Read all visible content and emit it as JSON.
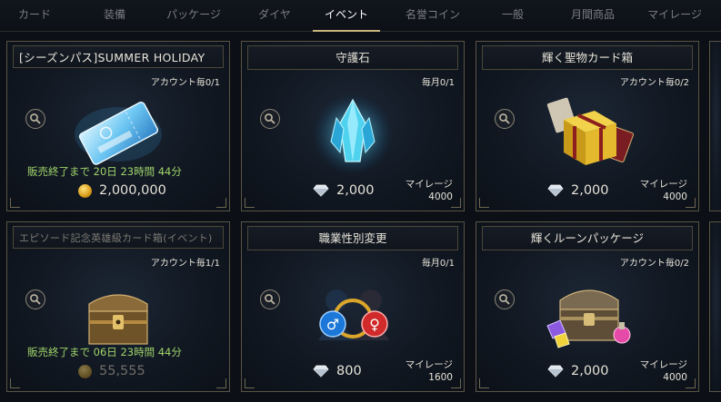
{
  "tabs": [
    {
      "label": "カード"
    },
    {
      "label": "装備"
    },
    {
      "label": "パッケージ"
    },
    {
      "label": "ダイヤ"
    },
    {
      "label": "イベント",
      "active": true
    },
    {
      "label": "名誉コイン"
    },
    {
      "label": "一般"
    },
    {
      "label": "月間商品"
    },
    {
      "label": "マイレージ"
    }
  ],
  "cards": [
    {
      "title": "[シーズンパス]SUMMER HOLIDAY",
      "limit": "アカウント毎0/1",
      "item_icon": "season-pass-ticket-icon",
      "countdown": "販売終了まで 20日 23時間 44分",
      "currency_icon": "gold-coin-icon",
      "price": "2,000,000"
    },
    {
      "title": "守護石",
      "limit": "毎月0/1",
      "item_icon": "guardian-stone-icon",
      "currency_icon": "diamond-icon",
      "price": "2,000",
      "mileage_label": "マイレージ",
      "mileage_value": "4000"
    },
    {
      "title": "輝く聖物カード箱",
      "limit": "アカウント毎0/2",
      "item_icon": "relic-card-box-icon",
      "currency_icon": "diamond-icon",
      "price": "2,000",
      "mileage_label": "マイレージ",
      "mileage_value": "4000"
    },
    {
      "title": "エピソード記念英雄級カード箱(イベント)",
      "limit": "アカウント毎1/1",
      "item_icon": "hero-card-chest-icon",
      "countdown": "販売終了まで 06日 23時間 44分",
      "currency_icon": "gold-coin-icon",
      "price": "55,555"
    },
    {
      "title": "職業性別変更",
      "limit": "毎月0/1",
      "item_icon": "gender-change-icon",
      "currency_icon": "diamond-icon",
      "price": "800",
      "mileage_label": "マイレージ",
      "mileage_value": "1600"
    },
    {
      "title": "輝くルーンパッケージ",
      "limit": "アカウント毎0/2",
      "item_icon": "rune-package-chest-icon",
      "currency_icon": "diamond-icon",
      "price": "2,000",
      "mileage_label": "マイレージ",
      "mileage_value": "4000"
    }
  ]
}
